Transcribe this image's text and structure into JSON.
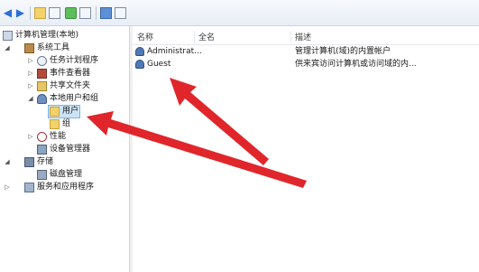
{
  "toolbar": {
    "icons": [
      "back-arrow-icon",
      "forward-arrow-icon",
      "up-folder-icon",
      "show-hide-tree-icon",
      "refresh-icon",
      "export-list-icon",
      "help-icon",
      "properties-icon"
    ]
  },
  "tree": {
    "root": "计算机管理(本地)",
    "system_tools": "系统工具",
    "task_scheduler": "任务计划程序",
    "event_viewer": "事件查看器",
    "shared_folders": "共享文件夹",
    "local_users_groups": "本地用户和组",
    "users": "用户",
    "groups": "组",
    "performance": "性能",
    "device_manager": "设备管理器",
    "storage": "存储",
    "disk_management": "磁盘管理",
    "services_apps": "服务和应用程序"
  },
  "list": {
    "columns": [
      "名称",
      "全名",
      "描述"
    ],
    "rows": [
      {
        "name": "Administrat...",
        "full_name": "",
        "description": "管理计算机(域)的内置帐户"
      },
      {
        "name": "Guest",
        "full_name": "",
        "description": "供来宾访问计算机或访问域的内..."
      }
    ]
  },
  "colors": {
    "arrow": "#e0262b",
    "selection": "#cce3f7"
  }
}
